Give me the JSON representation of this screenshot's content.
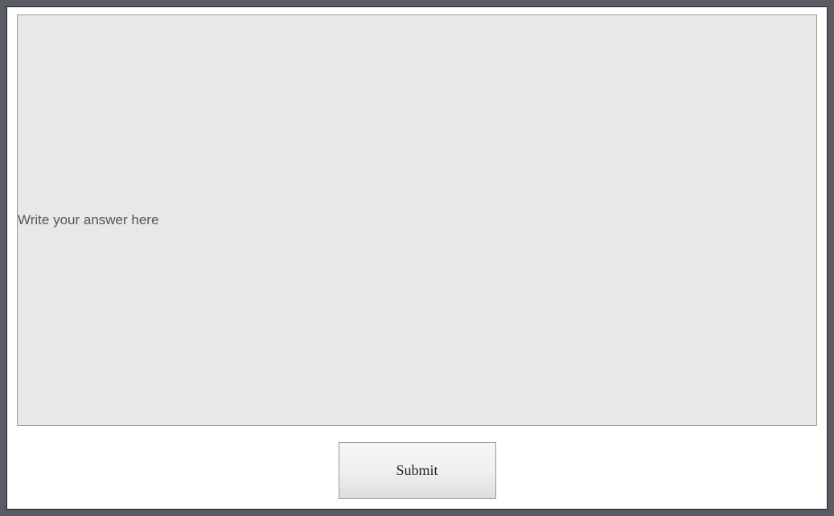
{
  "form": {
    "answer_placeholder": "Write your answer here",
    "submit_label": "Submit"
  }
}
